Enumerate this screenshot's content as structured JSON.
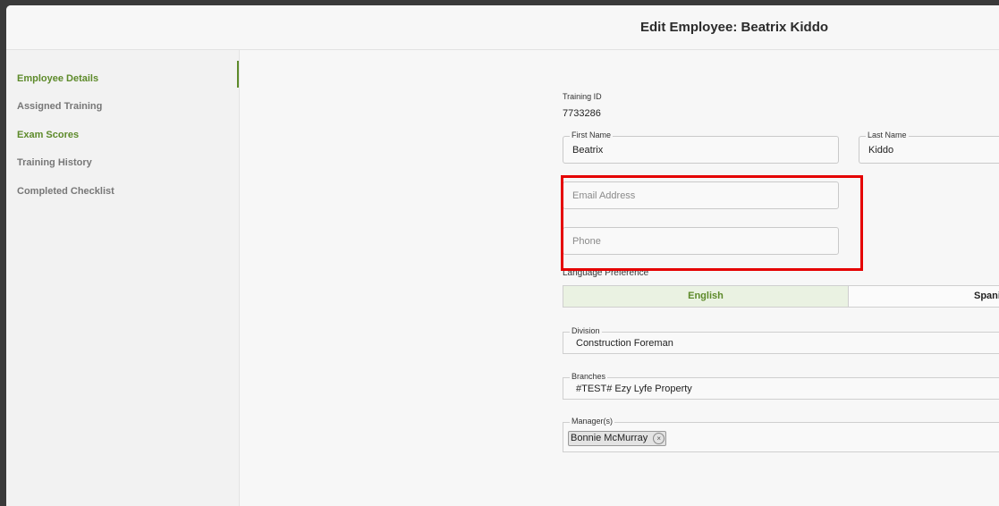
{
  "header": {
    "title": "Edit Employee: Beatrix Kiddo"
  },
  "sidebar": {
    "items": [
      {
        "label": "Employee Details"
      },
      {
        "label": "Assigned Training"
      },
      {
        "label": "Exam Scores"
      },
      {
        "label": "Training History"
      },
      {
        "label": "Completed Checklist"
      }
    ]
  },
  "form": {
    "training_id_label": "Training ID",
    "training_id_value": "7733286",
    "first_name": {
      "label": "First Name",
      "value": "Beatrix"
    },
    "last_name": {
      "label": "Last Name",
      "value": "Kiddo"
    },
    "email": {
      "placeholder": "Email Address"
    },
    "phone": {
      "placeholder": "Phone"
    },
    "language": {
      "label": "Language Preference",
      "options": [
        "English",
        "Spani"
      ],
      "selected": "English"
    },
    "division": {
      "label": "Division",
      "value": "Construction Foreman"
    },
    "branches": {
      "label": "Branches",
      "value": "#TEST# Ezy Lyfe Property"
    },
    "managers": {
      "label": "Manager(s)",
      "chips": [
        "Bonnie McMurray"
      ],
      "remove_glyph": "×"
    }
  },
  "colors": {
    "accent_green": "#5d8a2a",
    "highlight_red": "#e50000"
  }
}
